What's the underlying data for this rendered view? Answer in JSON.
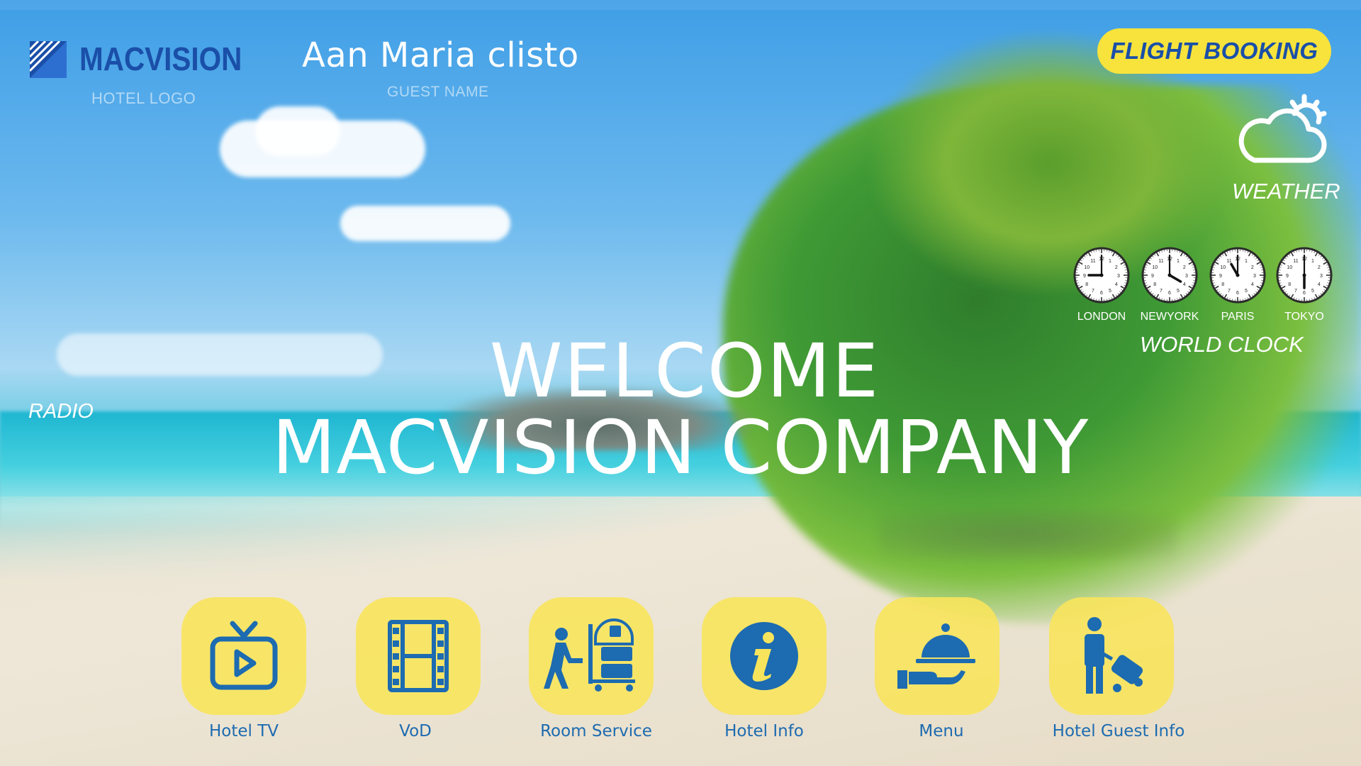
{
  "header": {
    "logo_text": "MACVISION",
    "logo_caption": "HOTEL LOGO",
    "guest_name": "Aan Maria clisto",
    "guest_caption": "GUEST NAME"
  },
  "flight_booking": {
    "label": "FLIGHT BOOKING"
  },
  "weather": {
    "label": "WEATHER",
    "icon": "cloud-sun-icon"
  },
  "world_clock": {
    "label": "WORLD CLOCK",
    "cities": [
      {
        "name": "LONDON",
        "hour": 9,
        "minute": 0
      },
      {
        "name": "NEWYORK",
        "hour": 4,
        "minute": 0
      },
      {
        "name": "PARIS",
        "hour": 11,
        "minute": 0
      },
      {
        "name": "TOKYO",
        "hour": 6,
        "minute": 0
      }
    ]
  },
  "radio": {
    "label": "RADIO"
  },
  "welcome": {
    "line1": "WELCOME",
    "line2": "MACVISION COMPANY"
  },
  "menu": [
    {
      "label": "Hotel TV",
      "icon": "tv-icon"
    },
    {
      "label": "VoD",
      "icon": "film-icon"
    },
    {
      "label": "Room Service",
      "icon": "room-service-icon"
    },
    {
      "label": "Hotel Info",
      "icon": "info-icon"
    },
    {
      "label": "Menu",
      "icon": "cloche-icon"
    },
    {
      "label": "Hotel Guest Info",
      "icon": "guest-luggage-icon"
    }
  ],
  "colors": {
    "brand_blue": "#1a4fa8",
    "accent_yellow": "#f7e33c",
    "tile_yellow": "#f8e45c",
    "tile_icon_blue": "#1d6bb0"
  }
}
